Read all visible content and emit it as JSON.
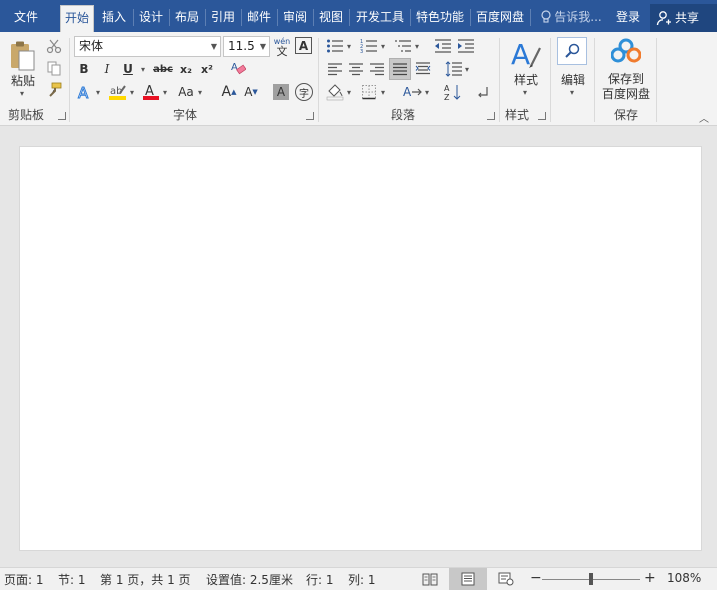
{
  "tabs": {
    "file": "文件",
    "home": "开始",
    "insert": "插入",
    "design": "设计",
    "layout": "布局",
    "references": "引用",
    "mailings": "邮件",
    "review": "审阅",
    "view": "视图",
    "developer": "开发工具",
    "special": "特色功能",
    "baidu": "百度网盘",
    "tell_me": "告诉我...",
    "login": "登录",
    "share": "共享"
  },
  "clipboard": {
    "paste": "粘贴",
    "label": "剪贴板"
  },
  "font": {
    "name": "宋体",
    "size": "11.5",
    "wen_top": "wén",
    "wen_bottom": "文",
    "bold": "B",
    "italic": "I",
    "underline": "U",
    "strike": "abc",
    "subscript": "x₂",
    "superscript": "x²",
    "change_case": "Aa",
    "grow": "A",
    "shrink": "A",
    "char_shading": "A",
    "enclose": "字",
    "label": "字体"
  },
  "paragraph": {
    "label": "段落"
  },
  "styles": {
    "button": "样式",
    "label": "样式"
  },
  "editing": {
    "button": "编辑"
  },
  "save": {
    "button_line1": "保存到",
    "button_line2": "百度网盘",
    "label": "保存"
  },
  "status": {
    "page": "页面: 1",
    "section": "节: 1",
    "page_of": "第 1 页，共 1 页",
    "setting": "设置值: 2.5厘米",
    "row": "行: 1",
    "col": "列: 1",
    "zoom": "108%"
  },
  "colors": {
    "ribbon_blue": "#2b579a",
    "highlight_yellow": "#ffd800",
    "font_red": "#e81123"
  }
}
